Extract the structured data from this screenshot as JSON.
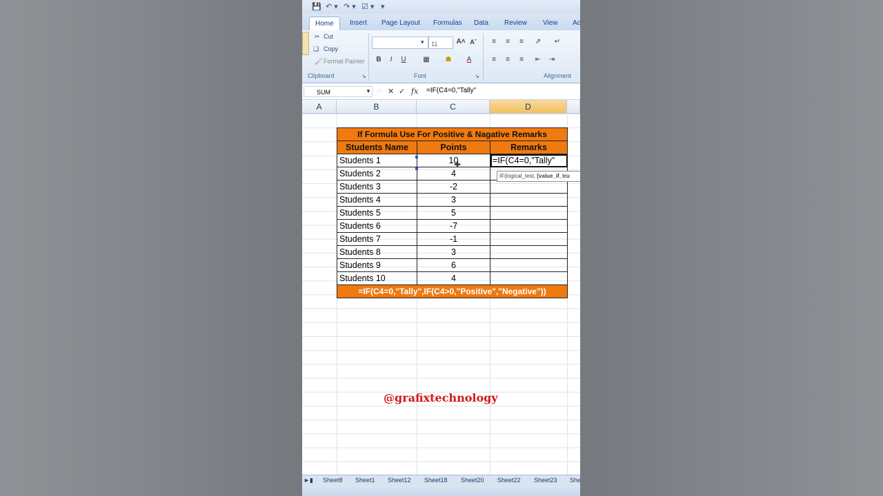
{
  "qat": {
    "undo_icon": "undo-icon",
    "redo_icon": "redo-icon",
    "save_icon": "save-icon"
  },
  "tabs": [
    "Home",
    "Insert",
    "Page Layout",
    "Formulas",
    "Data",
    "Review",
    "View",
    "Ac"
  ],
  "ribbon": {
    "clipboard": {
      "cut": "Cut",
      "copy": "Copy",
      "format_painter": "Format Painter",
      "label": "Clipboard"
    },
    "font": {
      "size": "11",
      "label": "Font"
    },
    "alignment": {
      "label": "Alignment"
    }
  },
  "formula_bar": {
    "name_box": "SUM",
    "input": "=IF(C4=0,\"Tally\""
  },
  "columns": [
    "A",
    "B",
    "C",
    "D"
  ],
  "table": {
    "title": "If Formula Use For Positive & Nagative Remarks",
    "headers": [
      "Students Name",
      "Points",
      "Remarks"
    ],
    "rows": [
      {
        "name": "Students 1",
        "points": "10",
        "remarks": "=IF(C4=0,\"Tally\""
      },
      {
        "name": "Students 2",
        "points": "4",
        "remarks": ""
      },
      {
        "name": "Students 3",
        "points": "-2",
        "remarks": ""
      },
      {
        "name": "Students 4",
        "points": "3",
        "remarks": ""
      },
      {
        "name": "Students 5",
        "points": "5",
        "remarks": ""
      },
      {
        "name": "Students 6",
        "points": "-7",
        "remarks": ""
      },
      {
        "name": "Students 7",
        "points": "-1",
        "remarks": ""
      },
      {
        "name": "Students 8",
        "points": "3",
        "remarks": ""
      },
      {
        "name": "Students 9",
        "points": "6",
        "remarks": ""
      },
      {
        "name": "Students 10",
        "points": "4",
        "remarks": ""
      }
    ],
    "footer": "=IF(C4=0,\"Tally\",IF(C4>0,\"Positive\",\"Negative\"))"
  },
  "tooltip": {
    "fn": "IF(",
    "arg1": "logical_test, ",
    "arg2": "[value_if_tru"
  },
  "watermark": "@grafixtechnology",
  "sheets": [
    "Sheet8",
    "Sheet1",
    "Sheet12",
    "Sheet18",
    "Sheet20",
    "Sheet22",
    "Sheet23",
    "She"
  ],
  "colors": {
    "orange": "#f07a10",
    "watermark": "#d01818"
  }
}
